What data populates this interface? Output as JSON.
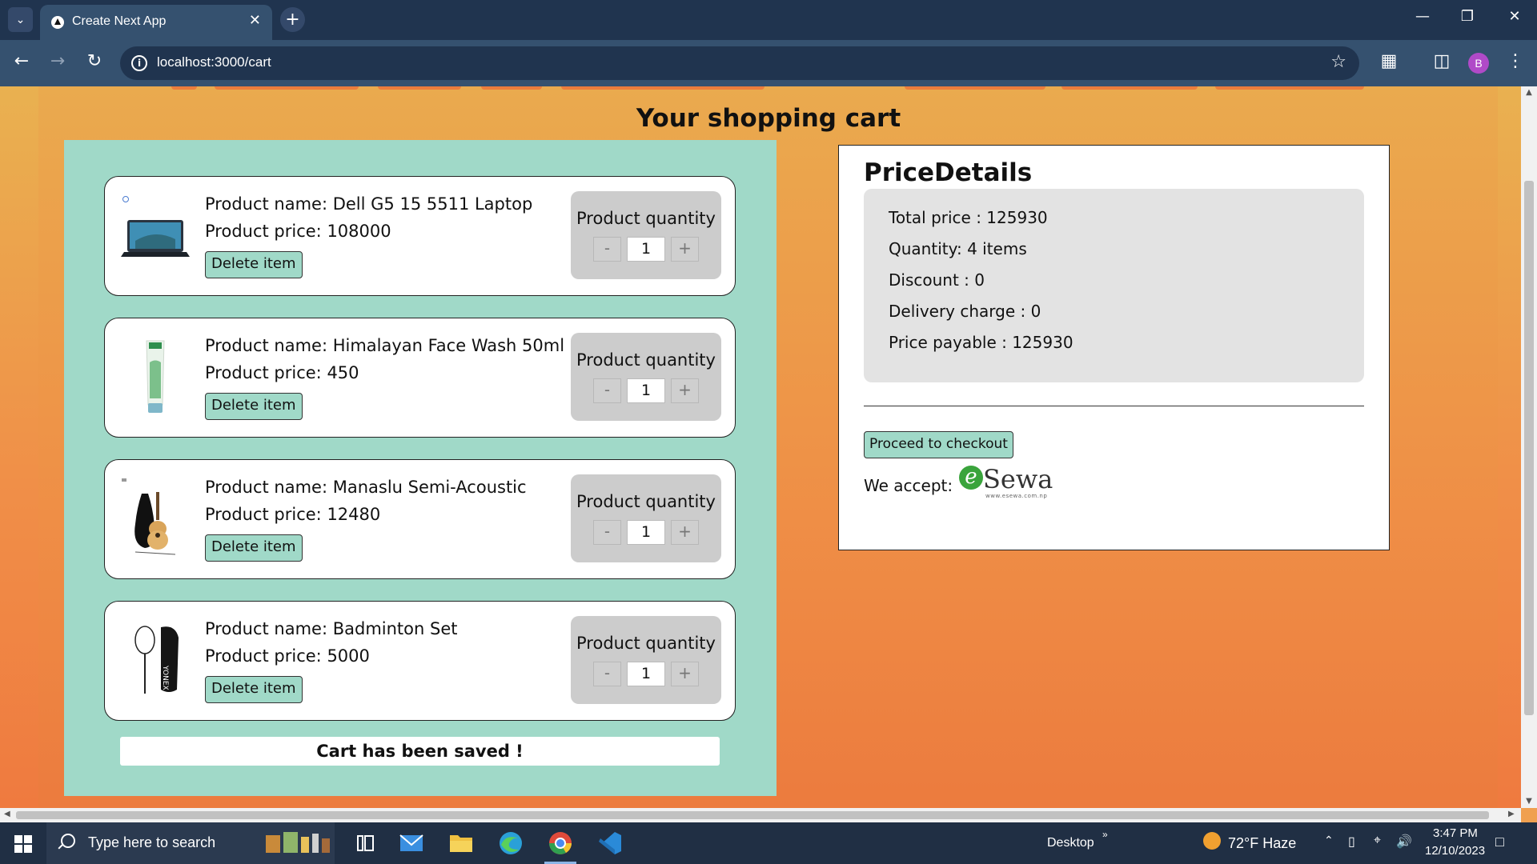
{
  "browser": {
    "tab_title": "Create Next App",
    "url": "localhost:3000/cart"
  },
  "page": {
    "title": "Your shopping cart",
    "qty_label": "Product quantity",
    "delete_label": "Delete item",
    "minus": "-",
    "plus": "+",
    "name_prefix": "Product name: ",
    "price_prefix": "Product price: ",
    "saved_message": "Cart has been saved !"
  },
  "cart": {
    "items": [
      {
        "name": "Dell G5 15 5511 Laptop",
        "price": "108000",
        "quantity": "1",
        "image": "laptop-image"
      },
      {
        "name": "Himalayan Face Wash 50ml",
        "price": "450",
        "quantity": "1",
        "image": "face-wash-image"
      },
      {
        "name": "Manaslu Semi-Acoustic",
        "price": "12480",
        "quantity": "1",
        "image": "guitar-image"
      },
      {
        "name": "Badminton Set",
        "price": "5000",
        "quantity": "1",
        "image": "badminton-image"
      }
    ]
  },
  "price_details": {
    "title": "PriceDetails",
    "total": "Total price : 125930",
    "quantity": "Quantity: 4 items",
    "discount": "Discount : 0",
    "delivery": "Delivery charge : 0",
    "payable": "Price payable : 125930",
    "checkout_label": "Proceed to checkout",
    "accept_label": "We accept:",
    "payment_logo_text": "eSewa",
    "payment_logo_sub": "www.esewa.com.np"
  },
  "taskbar": {
    "search_placeholder": "Type here to search",
    "desktop_label": "Desktop",
    "weather": "72°F  Haze",
    "time": "3:47 PM",
    "date": "12/10/2023"
  },
  "colors": {
    "accent_mint": "#a0d9c8",
    "page_gradient_top": "#e9b150",
    "page_gradient_bottom": "#ef7a3f",
    "chrome_dark": "#20344f"
  }
}
